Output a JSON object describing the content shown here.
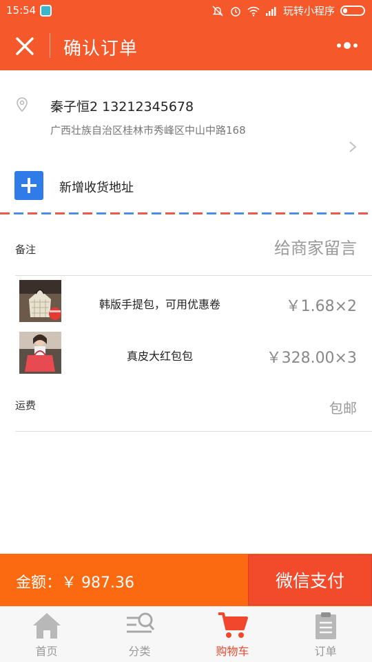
{
  "status_bar": {
    "time": "15:54",
    "app_name": "玩转小程序"
  },
  "navbar": {
    "title": "确认订单",
    "close_icon": "close-icon",
    "more_icon": "more-icon"
  },
  "address": {
    "name_phone": "秦子恒2 13212345678",
    "detail": "广西壮族自治区桂林市秀峰区中山中路168"
  },
  "add_address": {
    "label": "新增收货地址"
  },
  "remark": {
    "label": "备注",
    "placeholder": "给商家留言"
  },
  "products": [
    {
      "name": "韩版手提包，可用优惠卷",
      "price": "￥1.68×2"
    },
    {
      "name": "真皮大红包包",
      "price": "￥328.00×3"
    }
  ],
  "shipping": {
    "label": "运费",
    "value": "包邮"
  },
  "pay": {
    "amount_label": "金额：￥ 987.36",
    "button_label": "微信支付"
  },
  "tabs": [
    {
      "label": "首页",
      "icon": "home-icon"
    },
    {
      "label": "分类",
      "icon": "category-search-icon"
    },
    {
      "label": "购物车",
      "icon": "cart-icon",
      "active": true
    },
    {
      "label": "订单",
      "icon": "clipboard-icon"
    }
  ],
  "colors": {
    "brand": "#f5582a",
    "pay_bar": "#fb6a10",
    "pay_button": "#f24b2c",
    "tab_active": "#f1472c",
    "add_button": "#2f7ce8"
  }
}
